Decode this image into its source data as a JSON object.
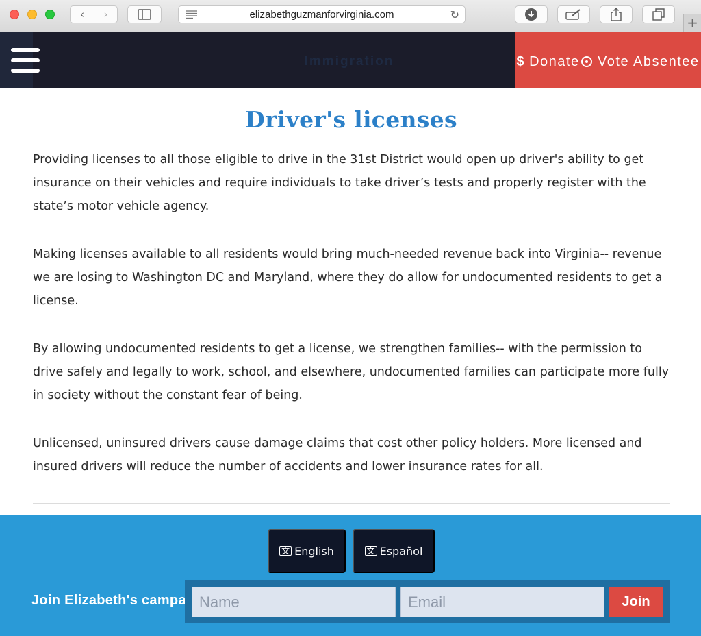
{
  "browser": {
    "url": "elizabethguzmanforvirginia.com",
    "back_glyph": "‹",
    "forward_glyph": "›",
    "reload_glyph": "↻",
    "new_tab_glyph": "+",
    "icons": [
      "back-icon",
      "forward-icon",
      "sidebar-icon",
      "reader-icon",
      "reload-icon",
      "download-icon",
      "markup-icon",
      "share-icon",
      "tabs-icon",
      "plus-icon"
    ]
  },
  "header": {
    "title": "Immigration",
    "donate_label": "Donate",
    "donate_icon_glyph": "$",
    "vote_label": "Vote Absentee",
    "colors": {
      "bar": "#1b1c2a",
      "accent": "#dc4a42"
    }
  },
  "main": {
    "title": "Driver's licenses",
    "paragraphs": [
      "Providing licenses to all those eligible to drive in the 31st District would open up driver's ability to get insurance on their vehicles and require individuals to take driver’s tests and properly register with the state’s motor vehicle agency.",
      "Making licenses available to all residents would bring much-needed revenue back into Virginia-- revenue we are losing to Washington DC and Maryland, where they do allow for undocumented residents to get a license.",
      "By allowing undocumented residents to get a license, we strengthen families-- with the permission to drive safely and legally to work, school, and elsewhere, undocumented families can participate more fully in society without the constant fear of being.",
      "Unlicensed, uninsured drivers cause damage claims that cost other policy holders. More licensed and insured drivers will reduce the number of accidents and lower insurance rates for all."
    ],
    "title_color": "#2c80c8"
  },
  "footer": {
    "language_buttons": [
      {
        "label": "English"
      },
      {
        "label": "Español"
      }
    ],
    "join_label": "Join Elizabeth's campaign!",
    "name_placeholder": "Name",
    "email_placeholder": "Email",
    "join_button": "Join",
    "colors": {
      "background": "#2a9ad7",
      "button": "#0f1628"
    }
  }
}
